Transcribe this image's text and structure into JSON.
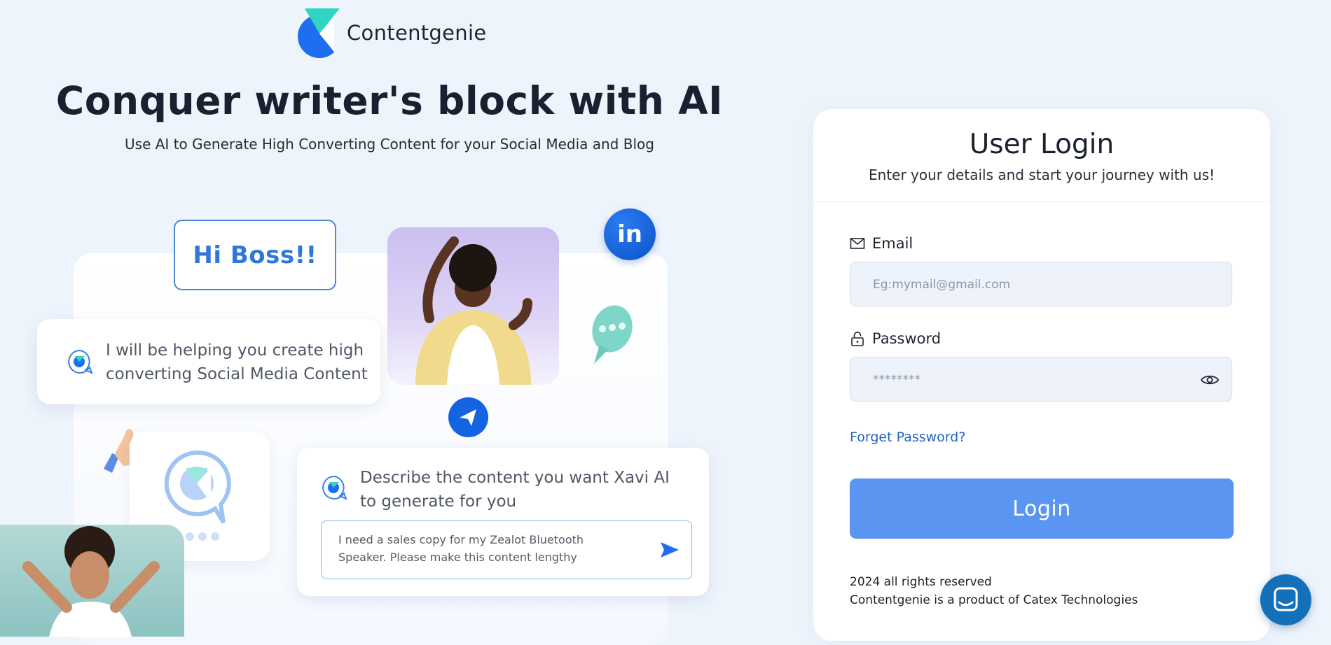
{
  "brand": {
    "name": "Contentgenie"
  },
  "hero": {
    "headline": "Conquer writer's block with AI",
    "subheadline": "Use AI to Generate High Converting Content for your Social Media and Blog"
  },
  "illustration": {
    "greeting": "Hi Boss!!",
    "helper_text": "I will be helping you create high converting Social Media Content",
    "describe_text": "Describe the content you want Xavi AI to generate for you",
    "prompt_example": "I need a sales copy for my Zealot Bluetooth Speaker. Please make this content lengthy",
    "social_badge": "in"
  },
  "login": {
    "title": "User Login",
    "subtitle": "Enter your details and start your journey with us!",
    "email_label": "Email",
    "email_placeholder": "Eg:mymail@gmail.com",
    "password_label": "Password",
    "password_placeholder": "********",
    "forgot_link": "Forget Password?",
    "submit_label": "Login"
  },
  "footer": {
    "copyright": "2024 all rights reserved",
    "product_note": "Contentgenie is a product of Catex Technologies"
  },
  "colors": {
    "page_bg": "#eef4fc",
    "accent": "#5b95f2",
    "link": "#2563c4",
    "brand_blue": "#1463e0",
    "brand_teal": "#2fd5c0"
  }
}
